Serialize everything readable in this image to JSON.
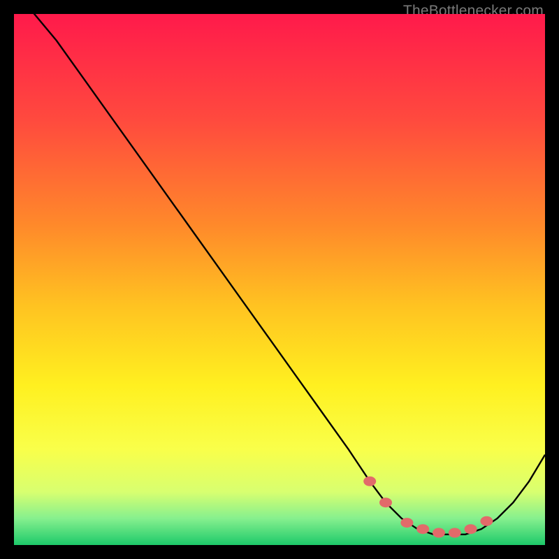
{
  "attribution": "TheBottlenecker.com",
  "chart_data": {
    "type": "line",
    "title": "",
    "xlabel": "",
    "ylabel": "",
    "xlim": [
      0,
      100
    ],
    "ylim": [
      0,
      100
    ],
    "x": [
      0,
      3,
      8,
      13,
      18,
      23,
      28,
      33,
      38,
      43,
      48,
      53,
      58,
      63,
      67,
      70,
      73,
      76,
      79,
      82,
      85,
      88,
      91,
      94,
      97,
      100
    ],
    "values": [
      105,
      101,
      95,
      88,
      81,
      74,
      67,
      60,
      53,
      46,
      39,
      32,
      25,
      18,
      12,
      8,
      5,
      3,
      2,
      2,
      2,
      3,
      5,
      8,
      12,
      17
    ],
    "markers": {
      "x": [
        67,
        70,
        74,
        77,
        80,
        83,
        86,
        89
      ],
      "y": [
        12,
        8,
        4.2,
        3,
        2.3,
        2.3,
        3,
        4.5
      ]
    },
    "gradient_stops": [
      {
        "offset": 0.0,
        "color": "#ff1a4b"
      },
      {
        "offset": 0.2,
        "color": "#ff4a3e"
      },
      {
        "offset": 0.4,
        "color": "#ff8a2a"
      },
      {
        "offset": 0.55,
        "color": "#ffc321"
      },
      {
        "offset": 0.7,
        "color": "#fff020"
      },
      {
        "offset": 0.82,
        "color": "#f9ff4a"
      },
      {
        "offset": 0.9,
        "color": "#d8ff70"
      },
      {
        "offset": 0.95,
        "color": "#86f08e"
      },
      {
        "offset": 1.0,
        "color": "#1dc96a"
      }
    ],
    "curve_color": "#000000",
    "marker_color": "#e26a6a"
  }
}
